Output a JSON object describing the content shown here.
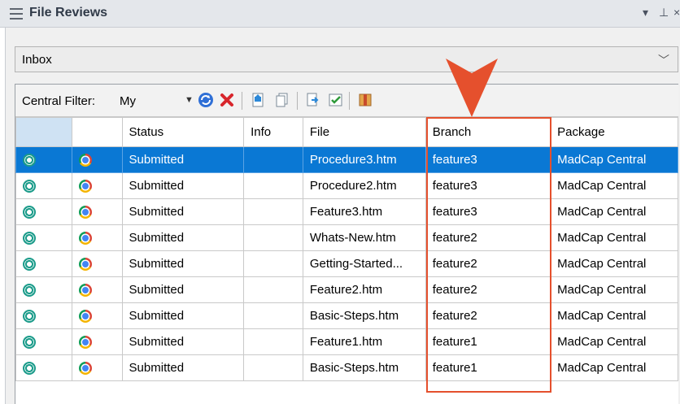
{
  "title_bar": {
    "title": "File Reviews",
    "dropdown_glyph": "▾",
    "pin_glyph": "⊥",
    "close_glyph": "×"
  },
  "inbox": {
    "selected": "Inbox"
  },
  "toolbar": {
    "filter_label": "Central Filter:",
    "filter_value": "My",
    "icons": [
      "refresh-icon",
      "delete-icon",
      "open-icon",
      "copy-icon",
      "export-icon",
      "accept-icon",
      "package-icon"
    ]
  },
  "table": {
    "columns": [
      "",
      "",
      "Status",
      "Info",
      "File",
      "Branch",
      "Package"
    ],
    "rows": [
      {
        "status": "Submitted",
        "info": "",
        "file": "Procedure3.htm",
        "branch": "feature3",
        "package": "MadCap Central"
      },
      {
        "status": "Submitted",
        "info": "",
        "file": "Procedure2.htm",
        "branch": "feature3",
        "package": "MadCap Central"
      },
      {
        "status": "Submitted",
        "info": "",
        "file": "Feature3.htm",
        "branch": "feature3",
        "package": "MadCap Central"
      },
      {
        "status": "Submitted",
        "info": "",
        "file": "Whats-New.htm",
        "branch": "feature2",
        "package": "MadCap Central"
      },
      {
        "status": "Submitted",
        "info": "",
        "file": "Getting-Started...",
        "branch": "feature2",
        "package": "MadCap Central"
      },
      {
        "status": "Submitted",
        "info": "",
        "file": "Feature2.htm",
        "branch": "feature2",
        "package": "MadCap Central"
      },
      {
        "status": "Submitted",
        "info": "",
        "file": "Basic-Steps.htm",
        "branch": "feature2",
        "package": "MadCap Central"
      },
      {
        "status": "Submitted",
        "info": "",
        "file": "Feature1.htm",
        "branch": "feature1",
        "package": "MadCap Central"
      },
      {
        "status": "Submitted",
        "info": "",
        "file": "Basic-Steps.htm",
        "branch": "feature1",
        "package": "MadCap Central"
      }
    ],
    "selected_row": 0
  },
  "colors": {
    "selection": "#0a78d4",
    "highlight": "#e5502d"
  }
}
